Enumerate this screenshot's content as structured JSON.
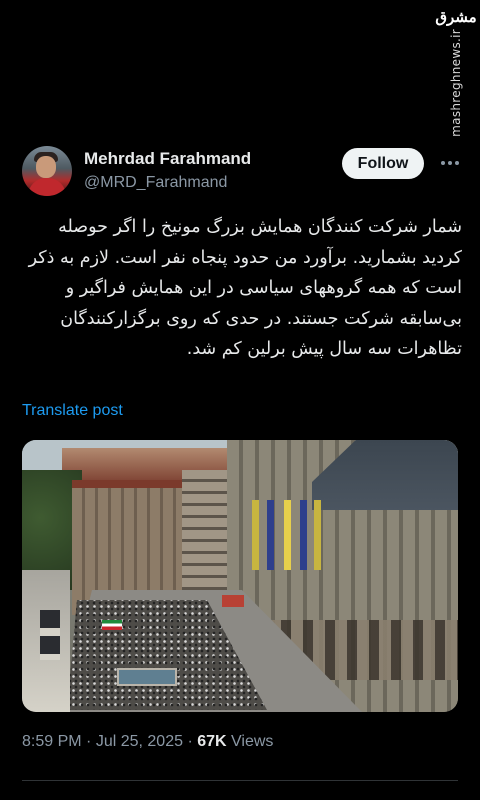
{
  "watermark": {
    "logo": "مشرق",
    "site": "mashreghnews.ir"
  },
  "author": {
    "display_name": "Mehrdad Farahmand",
    "handle": "@MRD_Farahmand"
  },
  "actions": {
    "follow_label": "Follow",
    "more_icon": "more-horizontal-icon"
  },
  "post": {
    "text": "شمار شرکت کنندگان همایش بزرگ مونیخ را اگر حوصله کردید بشمارید. برآورد من حدود پنجاه نفر است. لازم به ذکر است که همه گروههای سیاسی در این همایش فراگیر و بی‌سابقه شرکت جستند. در حدی که روی برگزارکنندگان تظاهرات سه سال پیش برلین کم شد.",
    "translate_label": "Translate post"
  },
  "meta": {
    "time": "8:59 PM",
    "separator1": " · ",
    "date": "Jul 25, 2025",
    "separator2": " · ",
    "views_count": "67K",
    "views_label": " Views"
  },
  "colors": {
    "background": "#000000",
    "link": "#1d9bf0",
    "muted": "#8b98a5"
  }
}
